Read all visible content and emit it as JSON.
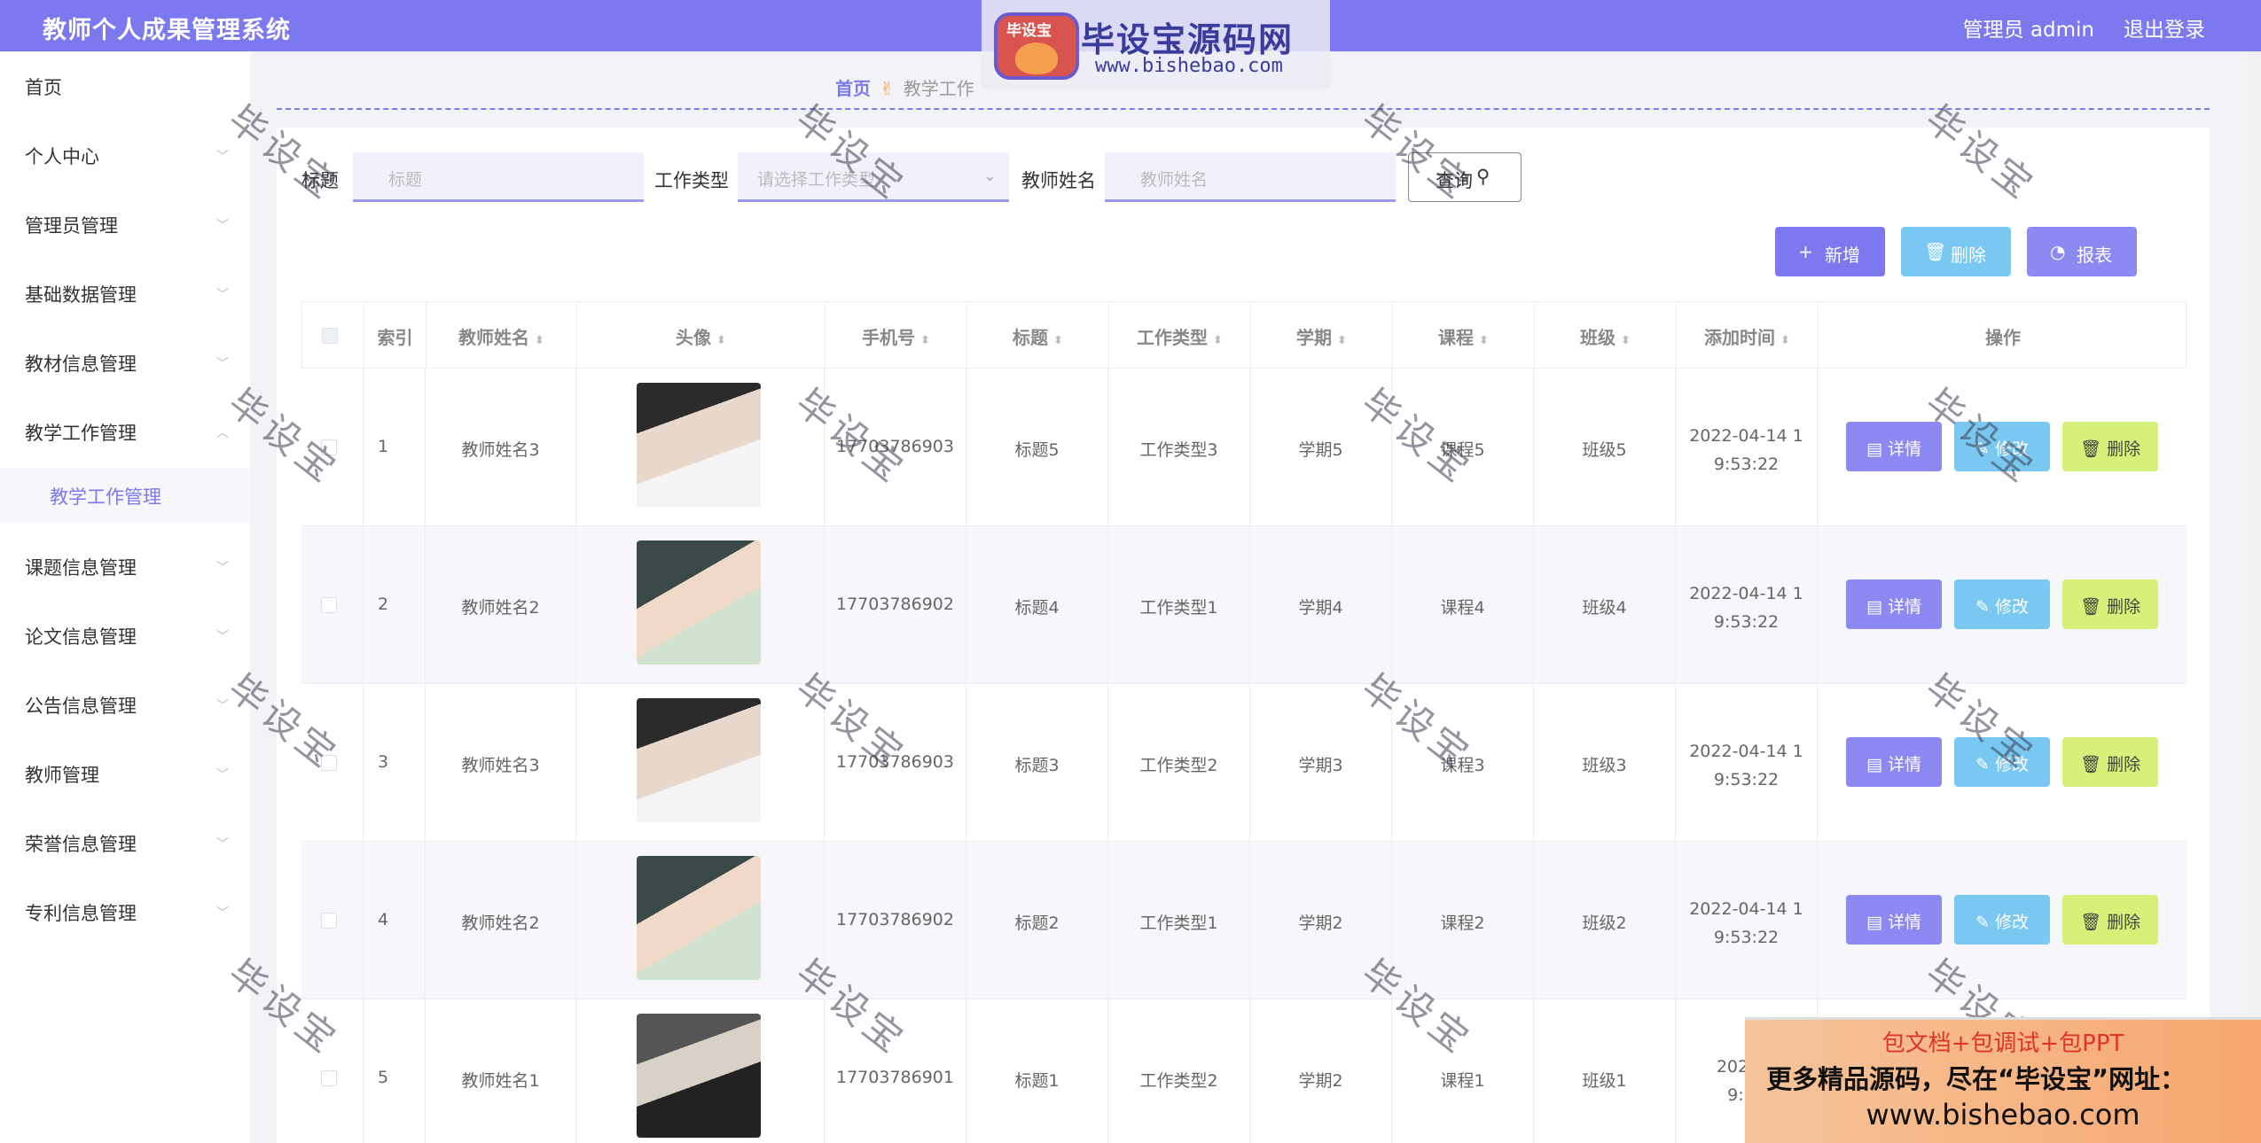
{
  "app": {
    "title": "教师个人成果管理系统",
    "user": "管理员 admin",
    "logout": "退出登录"
  },
  "logo": {
    "badge": "毕设宝",
    "title": "毕设宝源码网",
    "url": "www.bishebao.com"
  },
  "sidebar": {
    "items": [
      {
        "label": "首页"
      },
      {
        "label": "个人中心"
      },
      {
        "label": "管理员管理"
      },
      {
        "label": "基础数据管理"
      },
      {
        "label": "教材信息管理"
      },
      {
        "label": "教学工作管理"
      },
      {
        "label": "教学工作管理"
      },
      {
        "label": "课题信息管理"
      },
      {
        "label": "论文信息管理"
      },
      {
        "label": "公告信息管理"
      },
      {
        "label": "教师管理"
      },
      {
        "label": "荣誉信息管理"
      },
      {
        "label": "专利信息管理"
      }
    ]
  },
  "breadcrumb": {
    "home": "首页",
    "sep": "✌",
    "current": "教学工作"
  },
  "search": {
    "title_label": "标题",
    "title_placeholder": "标题",
    "type_label": "工作类型",
    "type_placeholder": "请选择工作类型",
    "teacher_label": "教师姓名",
    "teacher_placeholder": "教师姓名",
    "query_label": "查询"
  },
  "actions": {
    "add": "新增",
    "delete": "删除",
    "report": "报表"
  },
  "table": {
    "headers": [
      "索引",
      "教师姓名",
      "头像",
      "手机号",
      "标题",
      "工作类型",
      "学期",
      "课程",
      "班级",
      "添加时间",
      "操作"
    ],
    "rows": [
      {
        "index": "1",
        "teacher": "教师姓名3",
        "phone": "17703786903",
        "title": "标题5",
        "type": "工作类型3",
        "term": "学期5",
        "course": "课程5",
        "class": "班级5",
        "date": "2022-04-14 1",
        "time": "9:53:22"
      },
      {
        "index": "2",
        "teacher": "教师姓名2",
        "phone": "17703786902",
        "title": "标题4",
        "type": "工作类型1",
        "term": "学期4",
        "course": "课程4",
        "class": "班级4",
        "date": "2022-04-14 1",
        "time": "9:53:22"
      },
      {
        "index": "3",
        "teacher": "教师姓名3",
        "phone": "17703786903",
        "title": "标题3",
        "type": "工作类型2",
        "term": "学期3",
        "course": "课程3",
        "class": "班级3",
        "date": "2022-04-14 1",
        "time": "9:53:22"
      },
      {
        "index": "4",
        "teacher": "教师姓名2",
        "phone": "17703786902",
        "title": "标题2",
        "type": "工作类型1",
        "term": "学期2",
        "course": "课程2",
        "class": "班级2",
        "date": "2022-04-14 1",
        "time": "9:53:22"
      },
      {
        "index": "5",
        "teacher": "教师姓名1",
        "phone": "17703786901",
        "title": "标题1",
        "type": "工作类型2",
        "term": "学期2",
        "course": "课程1",
        "class": "班级1",
        "date": "2022-0",
        "time": "9:53"
      }
    ],
    "ops": {
      "detail": "详情",
      "edit": "修改",
      "delete": "删除"
    }
  },
  "ad": {
    "line1": "包文档+包调试+包PPT",
    "line2": "更多精品源码，尽在“毕设宝”网址：",
    "line3": "www.bishebao.com"
  },
  "watermark": "毕设宝",
  "colors": {
    "primary": "#7b78f0",
    "info": "#79c8f2",
    "warning": "#d7f07a"
  }
}
